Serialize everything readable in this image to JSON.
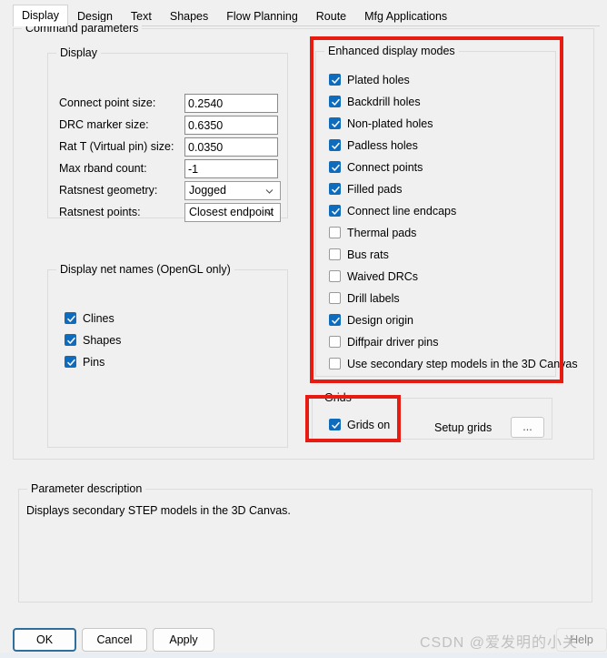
{
  "tabs": [
    {
      "label": "Display",
      "selected": true
    },
    {
      "label": "Design",
      "selected": false
    },
    {
      "label": "Text",
      "selected": false
    },
    {
      "label": "Shapes",
      "selected": false
    },
    {
      "label": "Flow Planning",
      "selected": false
    },
    {
      "label": "Route",
      "selected": false
    },
    {
      "label": "Mfg Applications",
      "selected": false
    }
  ],
  "groups": {
    "command_parameters": "Command parameters",
    "display": "Display",
    "display_net_names": "Display net names (OpenGL only)",
    "enhanced_display_modes": "Enhanced display modes",
    "grids": "Grids",
    "parameter_description": "Parameter description"
  },
  "display_fields": [
    {
      "label": "Connect point size:",
      "value": "0.2540",
      "type": "text"
    },
    {
      "label": "DRC marker size:",
      "value": "0.6350",
      "type": "text"
    },
    {
      "label": "Rat T (Virtual pin) size:",
      "value": "0.0350",
      "type": "text"
    },
    {
      "label": "Max rband count:",
      "value": "-1",
      "type": "text"
    },
    {
      "label": "Ratsnest geometry:",
      "value": "Jogged",
      "type": "select"
    },
    {
      "label": "Ratsnest points:",
      "value": "Closest endpoint",
      "type": "select"
    }
  ],
  "display_net_names": [
    {
      "label": "Clines",
      "checked": true
    },
    {
      "label": "Shapes",
      "checked": true
    },
    {
      "label": "Pins",
      "checked": true
    }
  ],
  "enhanced_display_modes": [
    {
      "label": "Plated holes",
      "checked": true
    },
    {
      "label": "Backdrill holes",
      "checked": true
    },
    {
      "label": "Non-plated holes",
      "checked": true
    },
    {
      "label": "Padless holes",
      "checked": true
    },
    {
      "label": "Connect points",
      "checked": true
    },
    {
      "label": "Filled pads",
      "checked": true
    },
    {
      "label": "Connect line endcaps",
      "checked": true
    },
    {
      "label": "Thermal pads",
      "checked": false
    },
    {
      "label": "Bus rats",
      "checked": false
    },
    {
      "label": "Waived DRCs",
      "checked": false
    },
    {
      "label": "Drill labels",
      "checked": false
    },
    {
      "label": "Design origin",
      "checked": true
    },
    {
      "label": "Diffpair driver pins",
      "checked": false
    },
    {
      "label": "Use secondary step models in the 3D Canvas",
      "checked": false
    }
  ],
  "grids": {
    "checkbox_label": "Grids on",
    "checkbox_checked": true,
    "setup_label": "Setup grids",
    "setup_button_label": "..."
  },
  "parameter_description": {
    "text": "Displays secondary STEP models in the 3D Canvas."
  },
  "footer": {
    "ok": "OK",
    "cancel": "Cancel",
    "apply": "Apply",
    "help": "Help"
  },
  "watermark": {
    "text": "CSDN @爱发明的小关"
  },
  "colors": {
    "checkbox_accent": "#0f6cbd",
    "highlight_red": "#e81b12",
    "panel_bg": "#f0f0f0",
    "focus_border": "#2e6f9e"
  }
}
